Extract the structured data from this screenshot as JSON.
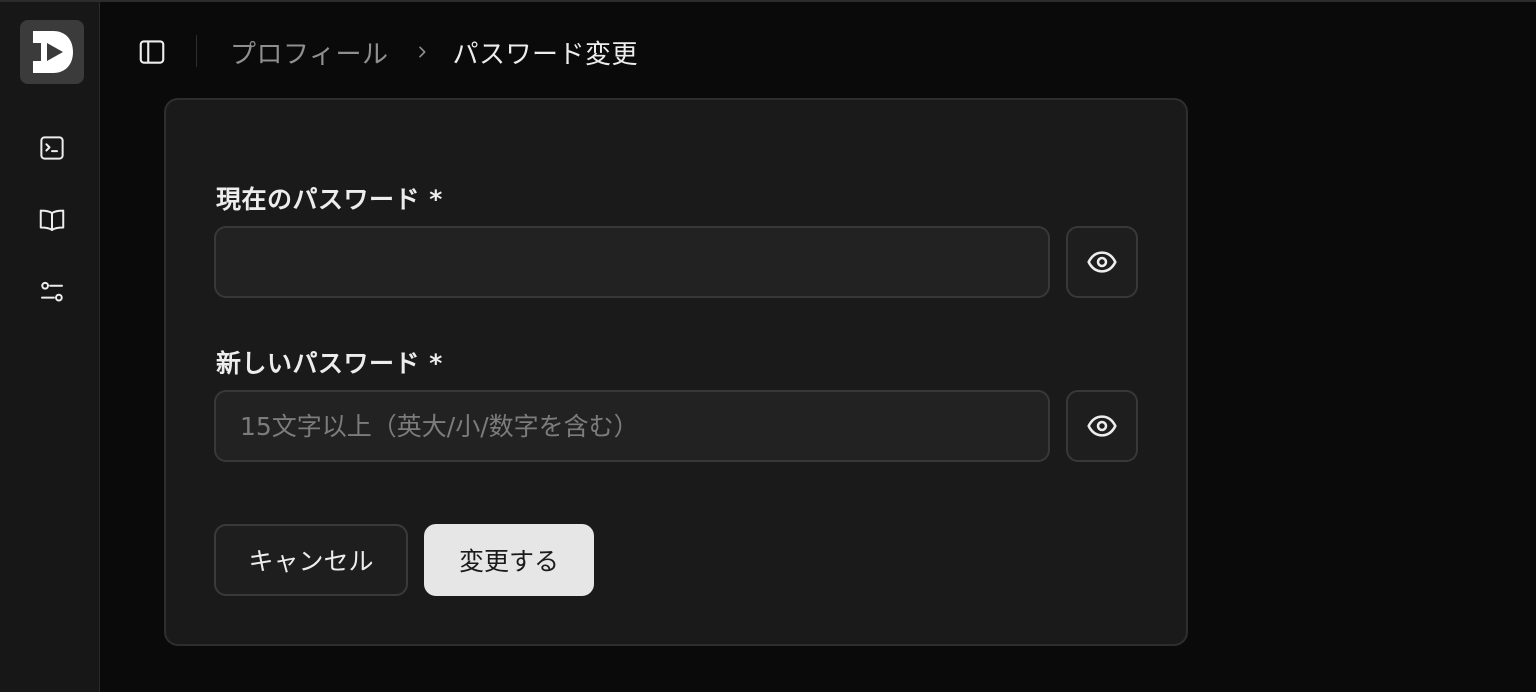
{
  "sidebar": {
    "logo_icon": "app-logo-d-play",
    "items": [
      {
        "name": "terminal",
        "icon": "terminal-icon"
      },
      {
        "name": "docs",
        "icon": "book-open-icon"
      },
      {
        "name": "settings",
        "icon": "sliders-icon"
      }
    ]
  },
  "header": {
    "toggle_icon": "panel-left-icon",
    "breadcrumb": {
      "parent": "プロフィール",
      "separator_icon": "chevron-right-icon",
      "current": "パスワード変更"
    }
  },
  "form": {
    "current_password": {
      "label": "現在のパスワード *",
      "value": "",
      "placeholder": "",
      "toggle_icon": "eye-icon"
    },
    "new_password": {
      "label": "新しいパスワード *",
      "value": "",
      "placeholder": "15文字以上（英大/小/数字を含む）",
      "toggle_icon": "eye-icon"
    },
    "cancel_label": "キャンセル",
    "submit_label": "変更する"
  },
  "colors": {
    "background": "#0a0a0a",
    "sidebar": "#171717",
    "card": "#1a1a1a",
    "primary_button": "#e6e6e6"
  }
}
